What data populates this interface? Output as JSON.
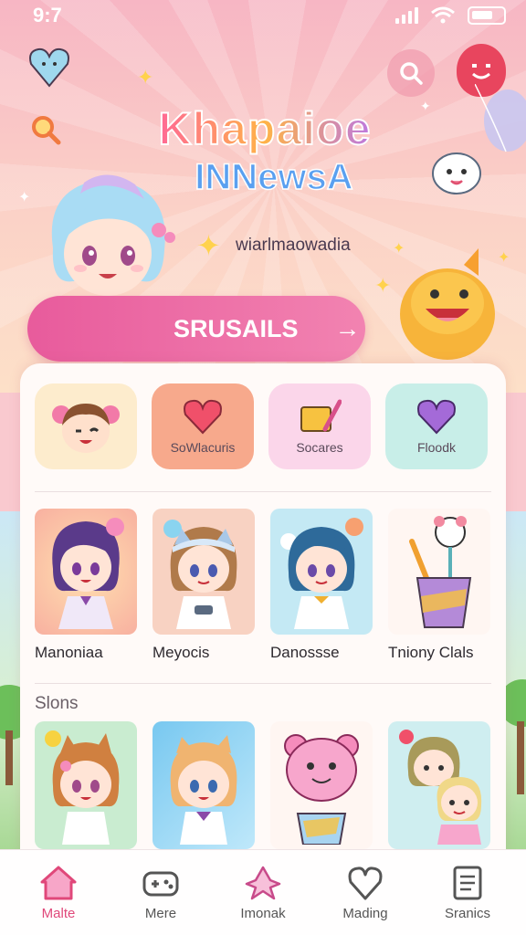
{
  "status_bar": {
    "time": "9:7",
    "carrier_glyph": "▇ ’"
  },
  "colors": {
    "accent": "#e0487a",
    "cta": "#e85b9c",
    "hero_bg": "#f7b6c4",
    "profile": "#e8455e"
  },
  "hero": {
    "title_line1": "Khapaioe",
    "title_line2": "INNewsA",
    "subtitle": "wiarlmaowadia",
    "cta_label": "SRUSAILS",
    "cta_arrow": "→"
  },
  "categories": [
    {
      "label": "",
      "icon": "boy-avatar-icon",
      "bg": "#fdeccd"
    },
    {
      "label": "SoWlacuris",
      "icon": "heart-icon",
      "bg": "#f7a98c"
    },
    {
      "label": "Socares",
      "icon": "ruler-pencil-icon",
      "bg": "#fbd6ea"
    },
    {
      "label": "Floodk",
      "icon": "heart-icon",
      "bg": "#c8eee8"
    }
  ],
  "featured": [
    {
      "label": "Manoniaa",
      "icon": "purple-hair-girl-icon",
      "bg": "#f8b9a8"
    },
    {
      "label": "Meyocis",
      "icon": "brown-hair-girl-icon",
      "bg": "#f8d2c2"
    },
    {
      "label": "Danossse",
      "icon": "blue-hair-girl-icon",
      "bg": "#c4e9f4"
    },
    {
      "label": "Tniony Clals",
      "icon": "pencil-cup-icon",
      "bg": "#fff6f2"
    }
  ],
  "section": {
    "title": "Slons"
  },
  "section_cards": [
    {
      "label": "",
      "icon": "orange-hair-girl-icon",
      "bg": "#c9ecd0"
    },
    {
      "label": "",
      "icon": "blonde-boy-icon",
      "bg": "#9ed8f0"
    },
    {
      "label": "",
      "icon": "pink-bear-icon",
      "bg": "#fff6f2"
    },
    {
      "label": "",
      "icon": "two-girls-icon",
      "bg": "#cfeef0"
    }
  ],
  "tabs": [
    {
      "label": "Malte",
      "icon": "home-icon",
      "active": true
    },
    {
      "label": "Mere",
      "icon": "gamepad-icon",
      "active": false
    },
    {
      "label": "Imonak",
      "icon": "character-icon",
      "active": false
    },
    {
      "label": "Mading",
      "icon": "heart-outline-icon",
      "active": false
    },
    {
      "label": "Sranics",
      "icon": "document-icon",
      "active": false
    }
  ]
}
